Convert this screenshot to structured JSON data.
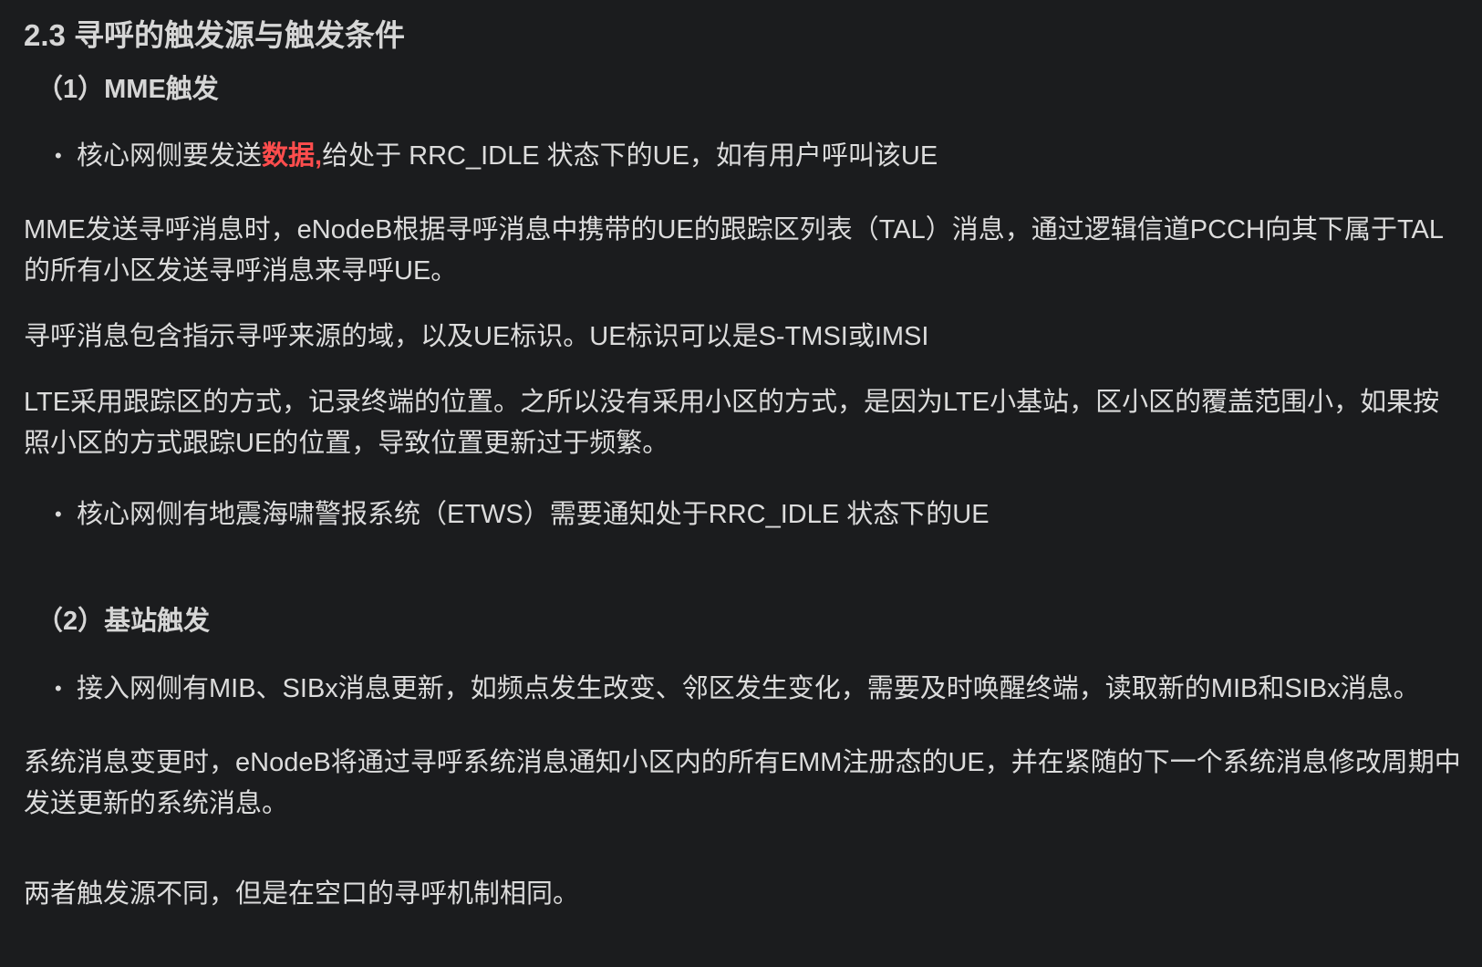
{
  "section_title": "2.3 寻呼的触发源与触发条件",
  "sub1_title": "（1）MME触发",
  "bullet1": {
    "before": "核心网侧要发送",
    "highlight": "数据,",
    "after": "给处于 RRC_IDLE 状态下的UE，如有用户呼叫该UE"
  },
  "para1": "MME发送寻呼消息时，eNodeB根据寻呼消息中携带的UE的跟踪区列表（TAL）消息，通过逻辑信道PCCH向其下属于TAL的所有小区发送寻呼消息来寻呼UE。",
  "para2": "寻呼消息包含指示寻呼来源的域，以及UE标识。UE标识可以是S-TMSI或IMSI",
  "para3": "LTE采用跟踪区的方式，记录终端的位置。之所以没有采用小区的方式，是因为LTE小基站，区小区的覆盖范围小，如果按照小区的方式跟踪UE的位置，导致位置更新过于频繁。",
  "bullet2": "核心网侧有地震海啸警报系统（ETWS）需要通知处于RRC_IDLE 状态下的UE",
  "sub2_title": "（2）基站触发",
  "bullet3": "接入网侧有MIB、SIBx消息更新，如频点发生改变、邻区发生变化，需要及时唤醒终端，读取新的MIB和SIBx消息。",
  "para4": "系统消息变更时，eNodeB将通过寻呼系统消息通知小区内的所有EMM注册态的UE，并在紧随的下一个系统消息修改周期中发送更新的系统消息。",
  "para5": "两者触发源不同，但是在空口的寻呼机制相同。",
  "colors": {
    "background": "#1b1c1e",
    "text": "#dcdcdc",
    "highlight": "#ff4d4d"
  }
}
